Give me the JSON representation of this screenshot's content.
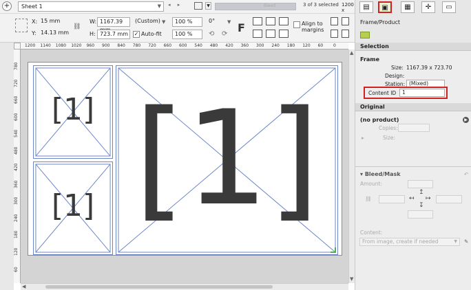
{
  "toolbar": {
    "add_symbol": "+",
    "sheet_name": "Sheet 1",
    "nav_arrows": "◂ ▸",
    "zoom_label": "Bleed",
    "selection_status": "3 of 3 selected",
    "zoom_value": "1200 x"
  },
  "geometry": {
    "x_label": "X:",
    "x_value": "15 mm",
    "y_label": "Y:",
    "y_value": "14.13 mm",
    "w_label": "W:",
    "w_value": "1167.39 mm",
    "h_label": "H:",
    "h_value": "723.7 mm",
    "size_preset": "(Custom)",
    "autofit_label": "Auto-fit",
    "autofit_checked": true,
    "scale_x": "100 %",
    "scale_y": "100 %",
    "rotation": "0°",
    "align_to_margins_label": "Align to margins"
  },
  "right_panel": {
    "header_title": "Frame/Product",
    "selection_heading": "Selection",
    "frame_heading": "Frame",
    "size_label": "Size:",
    "size_value": "1167.39 x 723.70",
    "design_label": "Design:",
    "station_label": "Station:",
    "station_value": "(Mixed)",
    "content_id_label": "Content ID",
    "content_id_value": "1",
    "original_heading": "Original",
    "no_product": "(no product)",
    "copies_label": "Copies:",
    "size2_label": "Size:",
    "bleed_heading": "Bleed/Mask",
    "amount_label": "Amount:",
    "content_label": "Content:",
    "content_value": "From image, create if needed"
  },
  "ruler": {
    "h_ticks": [
      "1200",
      "1140",
      "1080",
      "1020",
      "960",
      "900",
      "840",
      "780",
      "720",
      "660",
      "600",
      "540",
      "480",
      "420",
      "360",
      "300",
      "240",
      "180",
      "120",
      "60",
      "0"
    ],
    "v_ticks": [
      "780",
      "720",
      "660",
      "600",
      "540",
      "480",
      "420",
      "360",
      "300",
      "240",
      "180",
      "120",
      "60",
      "0"
    ]
  },
  "frames": [
    {
      "label": "[1]"
    },
    {
      "label": "[1]"
    },
    {
      "label": "[1]"
    }
  ],
  "colors": {
    "highlight": "#d02020",
    "frame_stroke": "#6b86c8",
    "canvas_bg": "#d4d4d4"
  }
}
